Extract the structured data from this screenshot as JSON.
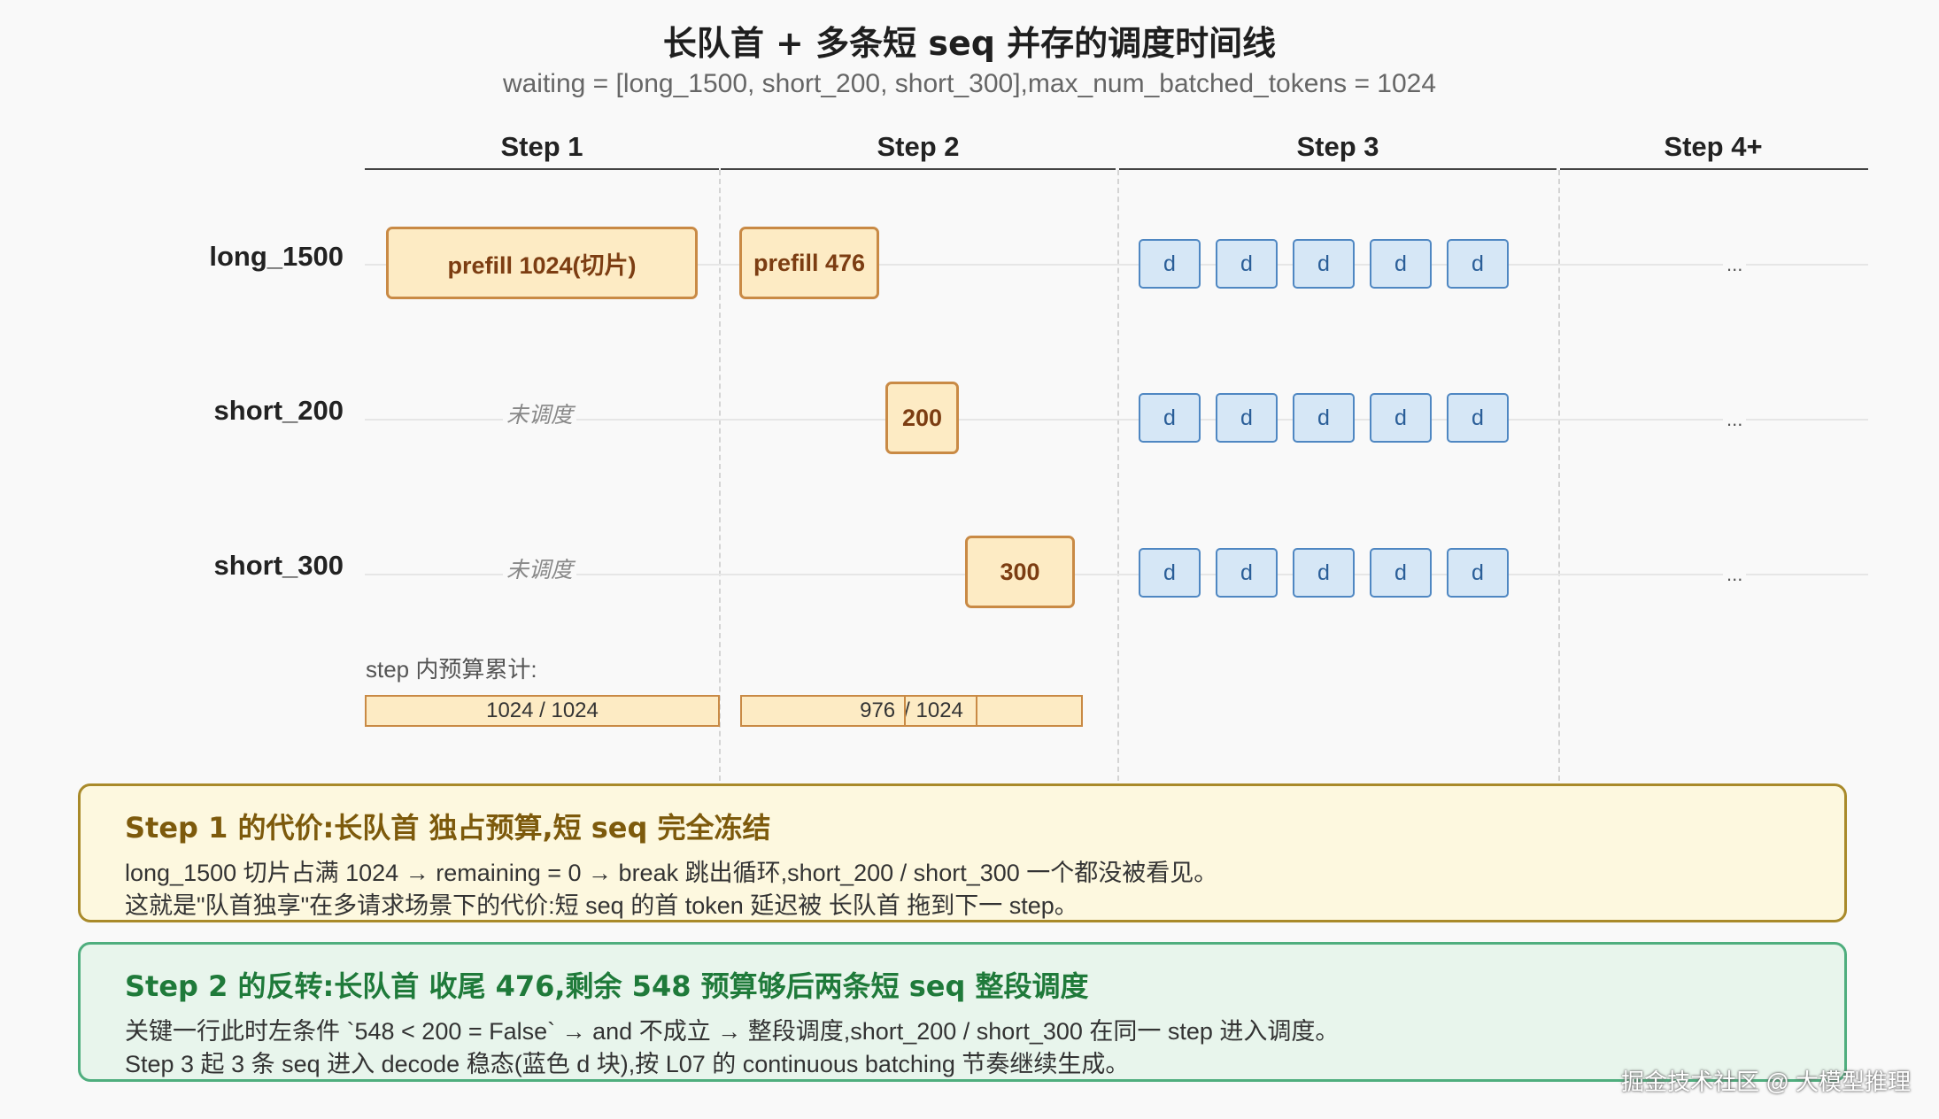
{
  "title": "长队首 + 多条短 seq 并存的调度时间线",
  "subtitle": "waiting = [long_1500, short_200, short_300],max_num_batched_tokens = 1024",
  "steps": [
    "Step 1",
    "Step 2",
    "Step 3",
    "Step 4+"
  ],
  "rows": [
    {
      "label": "long_1500"
    },
    {
      "label": "short_200",
      "step1": "未调度"
    },
    {
      "label": "short_300",
      "step1": "未调度"
    }
  ],
  "blocks": {
    "long_step1": "prefill 1024(切片)",
    "long_step2": "prefill 476",
    "short200_step2": "200",
    "short300_step2": "300"
  },
  "decode_label": "d",
  "ellipsis": "...",
  "budget": {
    "label": "step 内预算累计:",
    "step1": "1024 / 1024",
    "step2_used": "976",
    "step2_total": "/ 1024"
  },
  "notes": [
    {
      "title": "Step 1 的代价:长队首 独占预算,短 seq 完全冻结",
      "lines": [
        "long_1500 切片占满 1024 → remaining = 0 → break 跳出循环,short_200 / short_300 一个都没被看见。",
        "这就是\"队首独享\"在多请求场景下的代价:短 seq 的首 token 延迟被 长队首 拖到下一 step。"
      ]
    },
    {
      "title": "Step 2 的反转:长队首 收尾 476,剩余 548 预算够后两条短 seq 整段调度",
      "lines": [
        "关键一行此时左条件 `548 < 200 = False` → and 不成立 → 整段调度,short_200 / short_300 在同一 step 进入调度。",
        "Step 3 起 3 条 seq 进入 decode 稳态(蓝色 d 块),按 L07 的 continuous batching 节奏继续生成。"
      ]
    }
  ],
  "watermark": "掘金技术社区 @ 大模型推理"
}
